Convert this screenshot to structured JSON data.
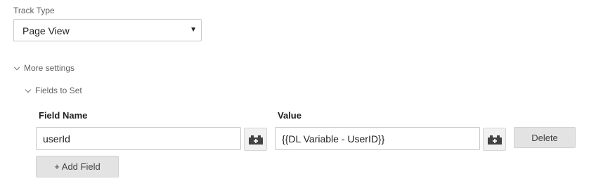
{
  "track_type": {
    "label": "Track Type",
    "selected": "Page View"
  },
  "more_settings": {
    "label": "More settings",
    "fields_to_set": {
      "label": "Fields to Set",
      "columns": {
        "name": "Field Name",
        "value": "Value"
      },
      "rows": [
        {
          "name": "userId",
          "value": "{{DL Variable - UserID}}",
          "delete_label": "Delete"
        }
      ],
      "add_label": "+ Add Field"
    }
  },
  "icons": {
    "variable_picker": "variable-brick-icon",
    "dropdown": "dropdown-arrow-icon",
    "expand": "chevron-down-icon"
  },
  "colors": {
    "icon": "#424242",
    "button_bg": "#e3e3e3",
    "border": "#c8c8c8"
  }
}
